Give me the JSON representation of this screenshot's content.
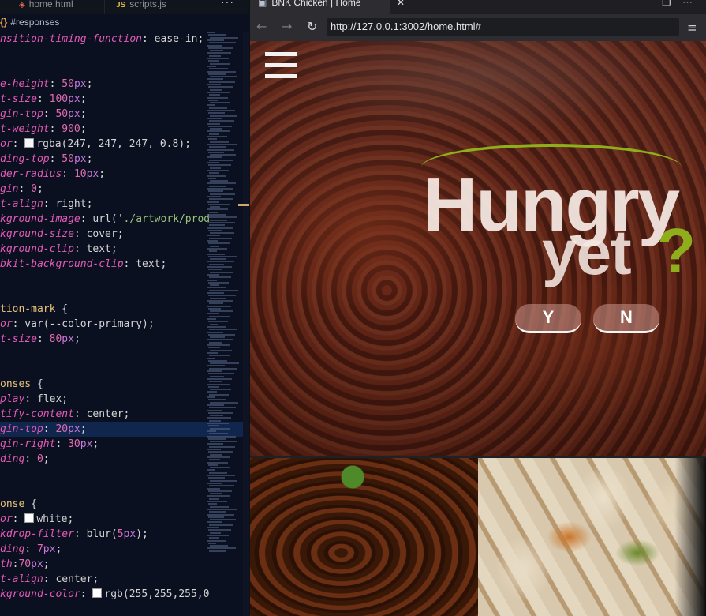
{
  "editor": {
    "tabs": [
      {
        "label": "home.html",
        "icon": "html-icon"
      },
      {
        "label": "scripts.js",
        "icon": "js-icon"
      }
    ],
    "tab_more": "···",
    "breadcrumb": "#responses",
    "lines": [
      [
        [
          "prop",
          "nsition-timing-function"
        ],
        [
          "kw",
          ": ease-in;"
        ]
      ],
      [],
      [],
      [
        [
          "prop",
          "e-height"
        ],
        [
          "kw",
          ": "
        ],
        [
          "num",
          "50"
        ],
        [
          "unit",
          "px"
        ],
        [
          "kw",
          ";"
        ]
      ],
      [
        [
          "prop",
          "t-size"
        ],
        [
          "kw",
          ": "
        ],
        [
          "num",
          "100"
        ],
        [
          "unit",
          "px"
        ],
        [
          "kw",
          ";"
        ]
      ],
      [
        [
          "prop",
          "gin-top"
        ],
        [
          "kw",
          ": "
        ],
        [
          "num",
          "50"
        ],
        [
          "unit",
          "px"
        ],
        [
          "kw",
          ";"
        ]
      ],
      [
        [
          "prop",
          "t-weight"
        ],
        [
          "kw",
          ": "
        ],
        [
          "num",
          "900"
        ],
        [
          "kw",
          ";"
        ]
      ],
      [
        [
          "prop",
          "or"
        ],
        [
          "kw",
          ": "
        ],
        [
          "swatch",
          "#f7f7f7"
        ],
        [
          "kw",
          "rgba(247, 247, 247, 0.8);"
        ]
      ],
      [
        [
          "prop",
          "ding-top"
        ],
        [
          "kw",
          ": "
        ],
        [
          "num",
          "50"
        ],
        [
          "unit",
          "px"
        ],
        [
          "kw",
          ";"
        ]
      ],
      [
        [
          "prop",
          "der-radius"
        ],
        [
          "kw",
          ": "
        ],
        [
          "num",
          "10"
        ],
        [
          "unit",
          "px"
        ],
        [
          "kw",
          ";"
        ]
      ],
      [
        [
          "prop",
          "gin"
        ],
        [
          "kw",
          ": "
        ],
        [
          "num",
          "0"
        ],
        [
          "kw",
          ";"
        ]
      ],
      [
        [
          "prop",
          "t-align"
        ],
        [
          "kw",
          ": right;"
        ]
      ],
      [
        [
          "prop",
          "kground-image"
        ],
        [
          "kw",
          ": url("
        ],
        [
          "str",
          "'./artwork/prod"
        ]
      ],
      [
        [
          "prop",
          "kground-size"
        ],
        [
          "kw",
          ": cover;"
        ]
      ],
      [
        [
          "prop",
          "kground-clip"
        ],
        [
          "kw",
          ": text;"
        ]
      ],
      [
        [
          "prop",
          "bkit-background-clip"
        ],
        [
          "kw",
          ": text;"
        ]
      ],
      [],
      [],
      [
        [
          "sel",
          "tion-mark"
        ],
        [
          "kw",
          " {"
        ]
      ],
      [
        [
          "prop",
          "or"
        ],
        [
          "kw",
          ": var(--color-primary);"
        ]
      ],
      [
        [
          "prop",
          "t-size"
        ],
        [
          "kw",
          ": "
        ],
        [
          "num",
          "80"
        ],
        [
          "unit",
          "px"
        ],
        [
          "kw",
          ";"
        ]
      ],
      [],
      [],
      [
        [
          "sel",
          "onses"
        ],
        [
          "kw",
          " {"
        ]
      ],
      [
        [
          "prop",
          "play"
        ],
        [
          "kw",
          ": flex;"
        ]
      ],
      [
        [
          "prop",
          "tify-content"
        ],
        [
          "kw",
          ": center;"
        ]
      ],
      [
        [
          "prop",
          "gin-top"
        ],
        [
          "kw",
          ": "
        ],
        [
          "num",
          "20"
        ],
        [
          "unit",
          "px"
        ],
        [
          "kw",
          ";"
        ]
      ],
      [
        [
          "prop",
          "gin-right"
        ],
        [
          "kw",
          ": "
        ],
        [
          "num",
          "30"
        ],
        [
          "unit",
          "px"
        ],
        [
          "kw",
          ";"
        ]
      ],
      [
        [
          "prop",
          "ding"
        ],
        [
          "kw",
          ": "
        ],
        [
          "num",
          "0"
        ],
        [
          "kw",
          ";"
        ]
      ],
      [],
      [],
      [
        [
          "sel",
          "onse"
        ],
        [
          "kw",
          " {"
        ]
      ],
      [
        [
          "prop",
          "or"
        ],
        [
          "kw",
          ": "
        ],
        [
          "swatch",
          "#ffffff"
        ],
        [
          "kw",
          "white;"
        ]
      ],
      [
        [
          "prop",
          "kdrop-filter"
        ],
        [
          "kw",
          ": blur("
        ],
        [
          "num",
          "5"
        ],
        [
          "unit",
          "px"
        ],
        [
          "kw",
          ");"
        ]
      ],
      [
        [
          "prop",
          "ding"
        ],
        [
          "kw",
          ": "
        ],
        [
          "num",
          "7"
        ],
        [
          "unit",
          "px"
        ],
        [
          "kw",
          ";"
        ]
      ],
      [
        [
          "prop",
          "th"
        ],
        [
          "kw",
          ":"
        ],
        [
          "num",
          "70"
        ],
        [
          "unit",
          "px"
        ],
        [
          "kw",
          ";"
        ]
      ],
      [
        [
          "prop",
          "t-align"
        ],
        [
          "kw",
          ": center;"
        ]
      ],
      [
        [
          "prop",
          "kground-color"
        ],
        [
          "kw",
          ": "
        ],
        [
          "swatch",
          "#ffffff"
        ],
        [
          "kw",
          "rgb(255,255,255,0"
        ]
      ]
    ]
  },
  "browser": {
    "tab_title": "BNK Chicken | Home",
    "tab_close": "✕",
    "window_controls": [
      "❐",
      "⋯"
    ],
    "nav": {
      "back": "←",
      "forward": "→",
      "reload": "↻"
    },
    "url": "http://127.0.0.1:3002/home.html#",
    "menu": "≡",
    "hero": {
      "headline": "Hungry",
      "headline2": "yet",
      "question_mark": "?",
      "responses": [
        "Y",
        "N"
      ]
    },
    "colors": {
      "primary": "#8fae1b"
    }
  }
}
